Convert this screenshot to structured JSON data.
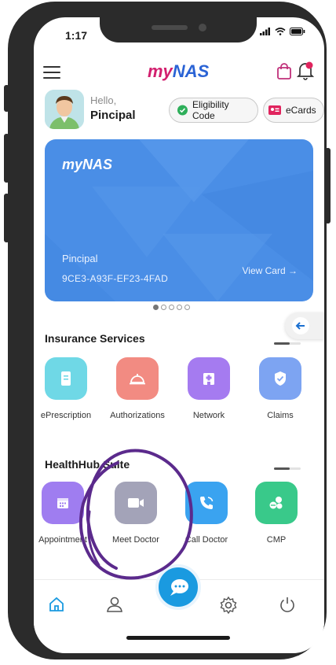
{
  "status_bar": {
    "time": "1:17"
  },
  "header": {
    "logo_part1": "my",
    "logo_part2": "NAS"
  },
  "profile": {
    "greeting": "Hello,",
    "name": "Pincipal",
    "eligibility_button": "Eligibility Code",
    "ecards_button": "eCards"
  },
  "card": {
    "logo": "myNAS",
    "holder_name": "Pincipal",
    "card_id": "9CE3-A93F-EF23-4FAD",
    "view_card": "View Card →",
    "carousel_pages": 5,
    "carousel_active": 1
  },
  "insurance_services": {
    "title": "Insurance Services",
    "items": [
      {
        "label": "ePrescription",
        "icon": "prescription-icon",
        "color": "#6fd8e6"
      },
      {
        "label": "Authorizations",
        "icon": "service-bell-icon",
        "color": "#f28b82"
      },
      {
        "label": "Network",
        "icon": "hospital-icon",
        "color": "#a57bf0"
      },
      {
        "label": "Claims",
        "icon": "shield-check-icon",
        "color": "#7da4f2"
      }
    ]
  },
  "healthhub": {
    "title": "HealthHub Suite",
    "items": [
      {
        "label": "Appointment",
        "icon": "calendar-icon",
        "color": "#9f7df0"
      },
      {
        "label": "Meet Doctor",
        "icon": "video-camera-icon",
        "color": "#a3a3b8"
      },
      {
        "label": "Call Doctor",
        "icon": "phone-icon",
        "color": "#3aa3f0"
      },
      {
        "label": "CMP",
        "icon": "pills-icon",
        "color": "#39c98a"
      }
    ]
  },
  "bottom_nav": {
    "items": [
      "home-icon",
      "profile-icon",
      "chat-icon",
      "settings-icon",
      "power-icon"
    ]
  },
  "colors": {
    "brand_pink": "#d21f6e",
    "brand_blue": "#2a63d5",
    "card_blue": "#4a8ee6",
    "fab_blue": "#1a9ae0",
    "annotation_purple": "#5b2a8c"
  }
}
